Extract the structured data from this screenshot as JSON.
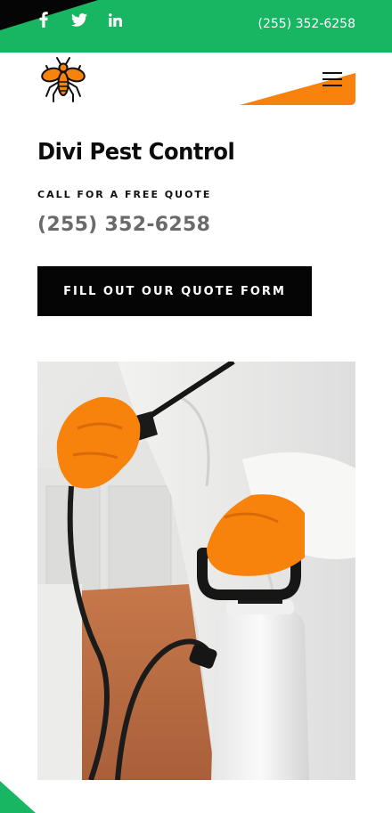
{
  "topbar": {
    "phone": "(255) 352-6258",
    "social": [
      "facebook-icon",
      "twitter-icon",
      "linkedin-icon"
    ],
    "color": "#18b563"
  },
  "header": {
    "logo_icon": "mosquito-logo-icon",
    "menu_icon": "hamburger-icon",
    "accent": "#f7820c"
  },
  "hero": {
    "title": "Divi Pest Control",
    "subtitle": "CALL FOR A FREE QUOTE",
    "phone": "(255) 352-6258",
    "cta_label": "FILL OUT OUR QUOTE FORM"
  },
  "photo": {
    "subject": "pest-control-sprayer-image"
  }
}
